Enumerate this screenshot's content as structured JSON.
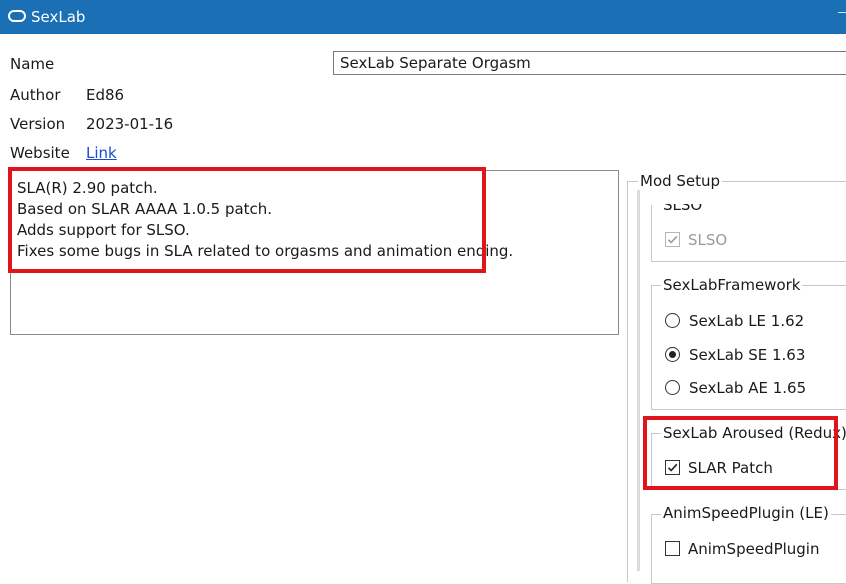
{
  "window": {
    "title": "SexLab"
  },
  "fields": {
    "name_label": "Name",
    "name_value": "SexLab Separate Orgasm",
    "author_label": "Author",
    "author_value": "Ed86",
    "version_label": "Version",
    "version_value": "2023-01-16",
    "website_label": "Website",
    "website_link": "Link"
  },
  "description": {
    "lines": [
      "SLA(R) 2.90 patch.",
      "Based on SLAR AAAA 1.0.5 patch.",
      "Adds support for SLSO.",
      "Fixes some bugs in SLA related to orgasms and animation ending."
    ]
  },
  "mod_setup": {
    "label": "Mod Setup",
    "groups": [
      {
        "title": "SLSO",
        "options": [
          {
            "label": "SLSO",
            "type": "checkbox",
            "checked": true,
            "disabled": true
          }
        ]
      },
      {
        "title": "SexLabFramework",
        "options": [
          {
            "label": "SexLab LE 1.62",
            "type": "radio",
            "checked": false
          },
          {
            "label": "SexLab SE 1.63",
            "type": "radio",
            "checked": true
          },
          {
            "label": "SexLab AE 1.65",
            "type": "radio",
            "checked": false
          }
        ]
      },
      {
        "title": "SexLab Aroused (Redux)",
        "options": [
          {
            "label": "SLAR Patch",
            "type": "checkbox",
            "checked": true
          }
        ]
      },
      {
        "title": "AnimSpeedPlugin (LE)",
        "options": [
          {
            "label": "AnimSpeedPlugin",
            "type": "checkbox",
            "checked": false
          }
        ]
      }
    ]
  },
  "colors": {
    "titlebar": "#1a6fb5",
    "highlight": "#e0141b",
    "link": "#1a4bd6"
  }
}
